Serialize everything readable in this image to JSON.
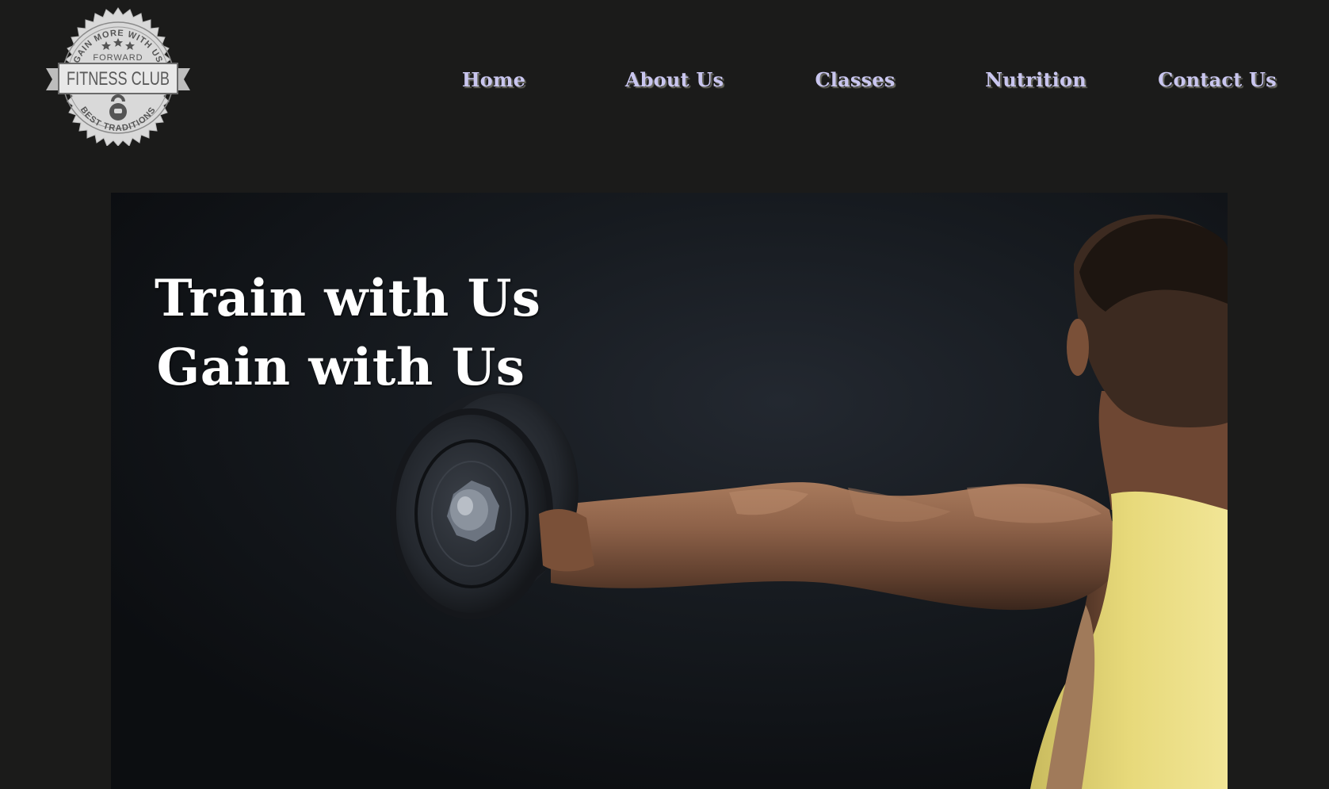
{
  "logo": {
    "top_arc_text": "GAIN MORE WITH US",
    "small_text": "FORWARD",
    "banner_text": "FITNESS CLUB",
    "bottom_arc_text": "BEST TRADITIONS",
    "icon": "kettlebell-icon"
  },
  "nav": {
    "items": [
      {
        "label": "Home"
      },
      {
        "label": "About Us"
      },
      {
        "label": "Classes"
      },
      {
        "label": "Nutrition"
      },
      {
        "label": "Contact Us"
      }
    ]
  },
  "hero": {
    "headline_line1": "Train with Us",
    "headline_line2": "Gain with Us",
    "image": "man-lifting-dumbbell-photo"
  },
  "colors": {
    "page_background": "#1b1b1a",
    "nav_text": "#c9c6ef",
    "nav_shadow": "#6b6b62",
    "headline_text": "#ffffff",
    "tank_top": "#e7d97a",
    "skin": "#9a6a4c"
  }
}
